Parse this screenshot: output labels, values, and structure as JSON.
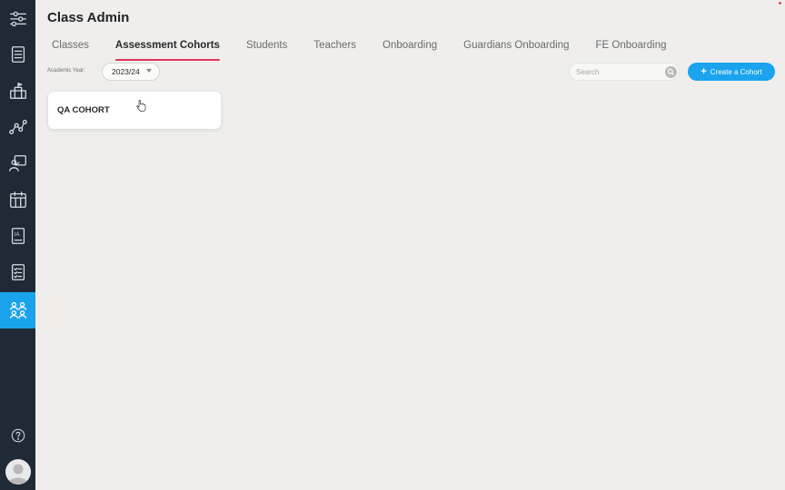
{
  "header": {
    "title": "Class Admin"
  },
  "tabs": [
    {
      "label": "Classes",
      "active": false
    },
    {
      "label": "Assessment Cohorts",
      "active": true
    },
    {
      "label": "Students",
      "active": false
    },
    {
      "label": "Teachers",
      "active": false
    },
    {
      "label": "Onboarding",
      "active": false
    },
    {
      "label": "Guardians Onboarding",
      "active": false
    },
    {
      "label": "FE Onboarding",
      "active": false
    }
  ],
  "filters": {
    "academic_year_label": "Academic Year:",
    "academic_year_value": "2023/24",
    "search_placeholder": "Search",
    "create_button_label": "Create a Cohort"
  },
  "cohorts": [
    {
      "name": "QA COHORT"
    }
  ],
  "sidebar": {
    "items": [
      {
        "icon": "sliders-icon",
        "active": false
      },
      {
        "icon": "list-icon",
        "active": false
      },
      {
        "icon": "school-icon",
        "active": false
      },
      {
        "icon": "analytics-icon",
        "active": false
      },
      {
        "icon": "teacher-board-icon",
        "active": false
      },
      {
        "icon": "calendar-icon",
        "active": false
      },
      {
        "icon": "ia-document-icon",
        "active": false
      },
      {
        "icon": "checklist-icon",
        "active": false
      },
      {
        "icon": "groups-icon",
        "active": true
      }
    ],
    "help_icon": "help-icon",
    "avatar_icon": "user-avatar-icon"
  },
  "colors": {
    "sidebar_bg": "#1f2a36",
    "accent_blue": "#1ba3ee",
    "tab_underline": "#e0335a",
    "page_bg": "#efeeec"
  }
}
